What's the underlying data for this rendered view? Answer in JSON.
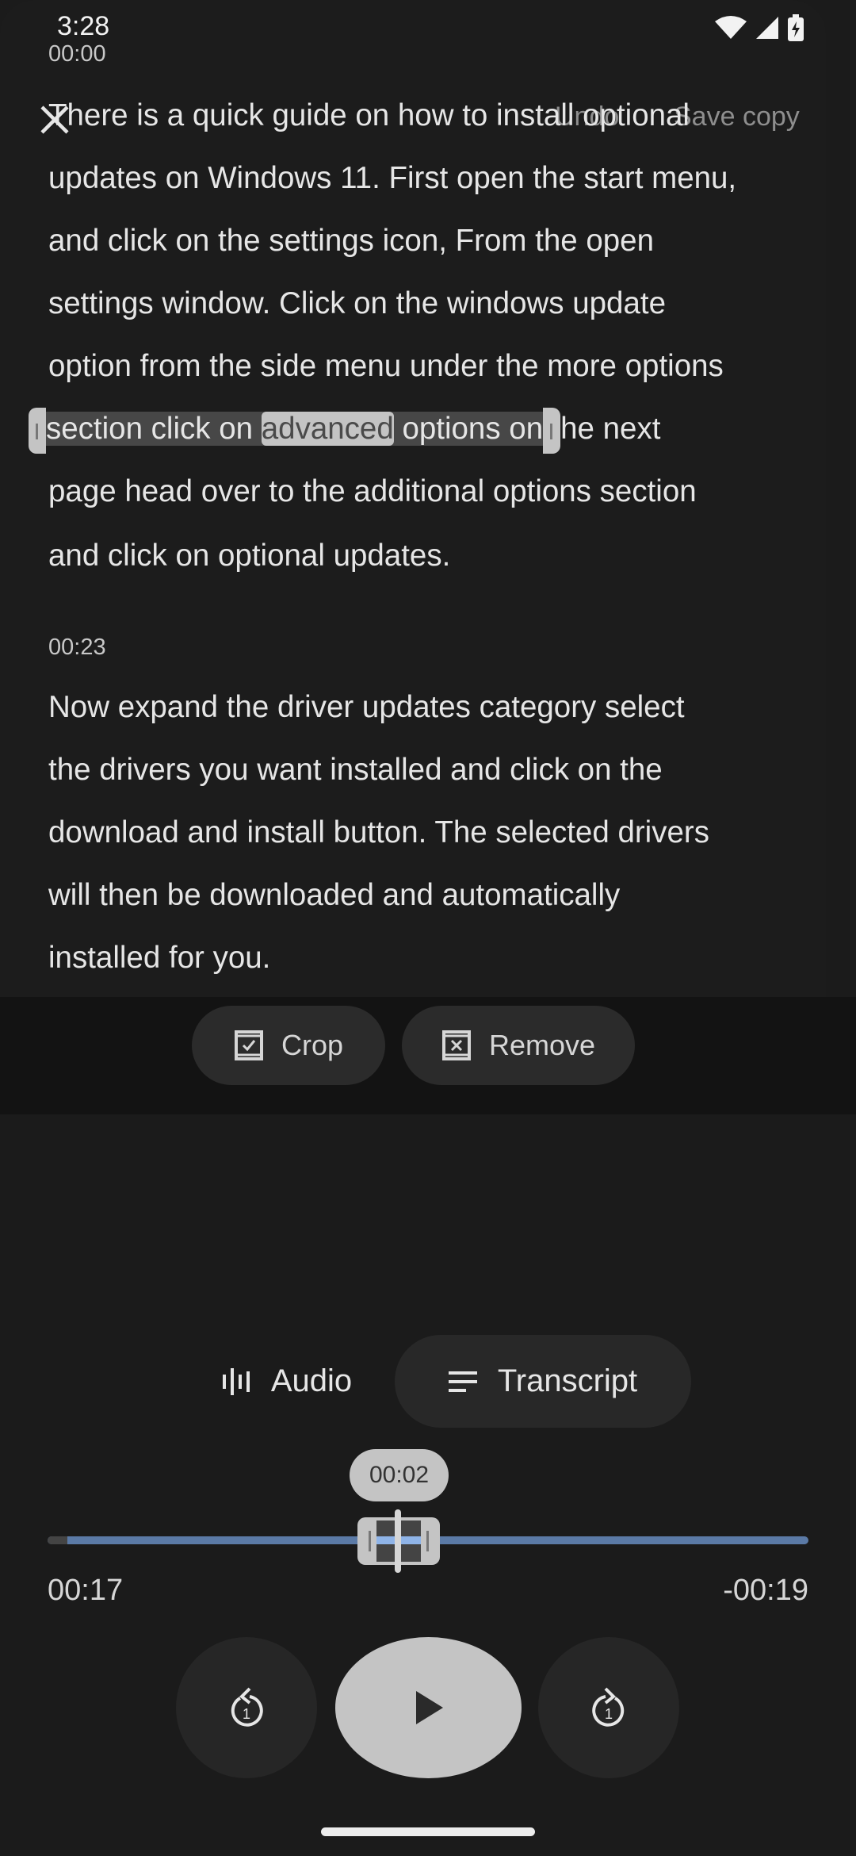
{
  "status_bar": {
    "time": "3:28",
    "icons": [
      "wifi-icon",
      "signal-icon",
      "battery-charging-icon"
    ]
  },
  "toolbar": {
    "close_icon": "close-icon",
    "undo_label": "Undo",
    "save_copy_label": "Save copy"
  },
  "transcript": {
    "sections": [
      {
        "timestamp": "00:00",
        "lines": [
          "There is a quick guide on how to install optional",
          "updates on Windows 11. First open the start menu,",
          "and click on the settings icon, From the open",
          "settings window. Click on the windows update",
          "option from the side menu under the more options",
          "",
          "page head over to the additional options section",
          "and click on optional updates."
        ],
        "selected_line": {
          "before_word": "section click on ",
          "selected_word": "advanced",
          "after_word": " options on",
          "after_selection": "he next"
        }
      },
      {
        "timestamp": "00:23",
        "lines": [
          "Now expand the driver updates category select",
          "the drivers you want installed and click on the",
          "download and install button. The selected drivers",
          "will then be downloaded and automatically",
          "installed for you."
        ]
      }
    ]
  },
  "edit_actions": {
    "crop_label": "Crop",
    "remove_label": "Remove"
  },
  "view_toggle": {
    "audio_label": "Audio",
    "transcript_label": "Transcript",
    "selected": "Transcript"
  },
  "scrubber": {
    "selection_duration": "00:02",
    "elapsed": "00:17",
    "remaining": "-00:19",
    "playhead_fraction": 0.47,
    "track_color": "#5b7aa6",
    "selection_color": "#8fb4e8"
  },
  "playback": {
    "rewind_seconds": "1",
    "forward_seconds": "1",
    "play_icon": "play-icon"
  }
}
